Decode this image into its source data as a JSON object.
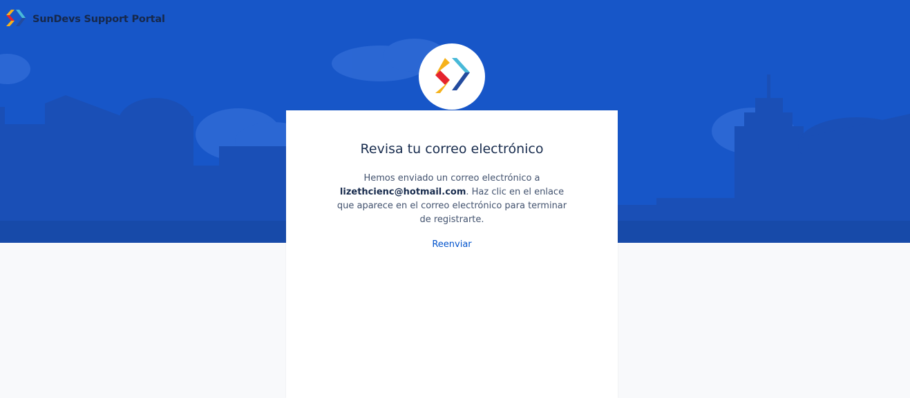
{
  "header": {
    "brand_name": "SunDevs Support Portal",
    "logo_icon": "sundevs-chevron-logo-icon"
  },
  "card": {
    "title": "Revisa tu correo electrónico",
    "message_prefix": "Hemos enviado un correo electrónico a",
    "email": "lizethcienc@hotmail.com",
    "message_suffix": ". Haz clic en el enlace que aparece en el correo electrónico para terminar de registrarte.",
    "resend_label": "Reenviar"
  },
  "colors": {
    "hero_blue": "#1756c8",
    "link": "#0052cc",
    "logo_red": "#e5232e",
    "logo_yellow": "#f6b21b",
    "logo_cyan": "#48b9d8",
    "logo_navy": "#234b9e"
  }
}
